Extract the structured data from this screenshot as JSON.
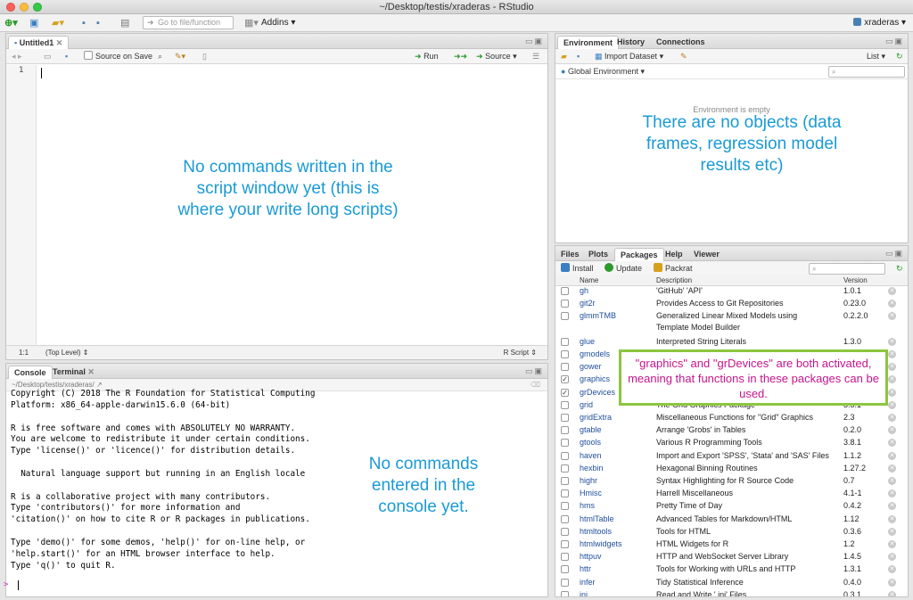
{
  "window": {
    "title": "~/Desktop/testis/xraderas - RStudio"
  },
  "toolbar": {
    "goto_placeholder": "Go to file/function",
    "addins": "Addins",
    "user": "xraderas"
  },
  "script": {
    "tab": "Untitled1",
    "source_on_save": "Source on Save",
    "run": "Run",
    "source": "Source",
    "line_number": "1",
    "position": "1:1",
    "level": "(Top Level)",
    "type": "R Script"
  },
  "console": {
    "tabs": [
      "Console",
      "Terminal"
    ],
    "path": "~/Desktop/testis/xraderas/",
    "lines": [
      "Copyright (C) 2018 The R Foundation for Statistical Computing",
      "Platform: x86_64-apple-darwin15.6.0 (64-bit)",
      "",
      "R is free software and comes with ABSOLUTELY NO WARRANTY.",
      "You are welcome to redistribute it under certain conditions.",
      "Type 'license()' or 'licence()' for distribution details.",
      "",
      "  Natural language support but running in an English locale",
      "",
      "R is a collaborative project with many contributors.",
      "Type 'contributors()' for more information and",
      "'citation()' on how to cite R or R packages in publications.",
      "",
      "Type 'demo()' for some demos, 'help()' for on-line help, or",
      "'help.start()' for an HTML browser interface to help.",
      "Type 'q()' to quit R.",
      ""
    ],
    "prompt": ">"
  },
  "environment": {
    "tabs": [
      "Environment",
      "History",
      "Connections"
    ],
    "import_dataset": "Import Dataset",
    "list": "List",
    "global": "Global Environment",
    "empty_text": "Environment is empty"
  },
  "packages": {
    "tabs": [
      "Files",
      "Plots",
      "Packages",
      "Help",
      "Viewer"
    ],
    "install": "Install",
    "update": "Update",
    "packrat": "Packrat",
    "columns": {
      "name": "Name",
      "description": "Description",
      "version": "Version"
    },
    "rows": [
      {
        "name": "gh",
        "description": "'GitHub' 'API'",
        "version": "1.0.1",
        "checked": false
      },
      {
        "name": "git2r",
        "description": "Provides Access to Git Repositories",
        "version": "0.23.0",
        "checked": false
      },
      {
        "name": "glmmTMB",
        "description": "Generalized Linear Mixed Models using",
        "description2": "Template Model Builder",
        "version": "0.2.2.0",
        "checked": false
      },
      {
        "name": "glue",
        "description": "Interpreted String Literals",
        "version": "1.3.0",
        "checked": false
      },
      {
        "name": "gmodels",
        "description": "Various R Programming Tools for Model Fitting",
        "version": "2.18.1",
        "checked": false
      },
      {
        "name": "gower",
        "description": "",
        "version": "",
        "checked": false
      },
      {
        "name": "graphics",
        "description": "",
        "version": "",
        "checked": true
      },
      {
        "name": "grDevices",
        "description": "",
        "version": "",
        "checked": true
      },
      {
        "name": "grid",
        "description": "The Grid Graphics Package",
        "version": "3.5.1",
        "checked": false
      },
      {
        "name": "gridExtra",
        "description": "Miscellaneous Functions for \"Grid\" Graphics",
        "version": "2.3",
        "checked": false
      },
      {
        "name": "gtable",
        "description": "Arrange 'Grobs' in Tables",
        "version": "0.2.0",
        "checked": false
      },
      {
        "name": "gtools",
        "description": "Various R Programming Tools",
        "version": "3.8.1",
        "checked": false
      },
      {
        "name": "haven",
        "description": "Import and Export 'SPSS', 'Stata' and 'SAS' Files",
        "version": "1.1.2",
        "checked": false
      },
      {
        "name": "hexbin",
        "description": "Hexagonal Binning Routines",
        "version": "1.27.2",
        "checked": false
      },
      {
        "name": "highr",
        "description": "Syntax Highlighting for R Source Code",
        "version": "0.7",
        "checked": false
      },
      {
        "name": "Hmisc",
        "description": "Harrell Miscellaneous",
        "version": "4.1-1",
        "checked": false
      },
      {
        "name": "hms",
        "description": "Pretty Time of Day",
        "version": "0.4.2",
        "checked": false
      },
      {
        "name": "htmlTable",
        "description": "Advanced Tables for Markdown/HTML",
        "version": "1.12",
        "checked": false
      },
      {
        "name": "htmltools",
        "description": "Tools for HTML",
        "version": "0.3.6",
        "checked": false
      },
      {
        "name": "htmlwidgets",
        "description": "HTML Widgets for R",
        "version": "1.2",
        "checked": false
      },
      {
        "name": "httpuv",
        "description": "HTTP and WebSocket Server Library",
        "version": "1.4.5",
        "checked": false
      },
      {
        "name": "httr",
        "description": "Tools for Working with URLs and HTTP",
        "version": "1.3.1",
        "checked": false
      },
      {
        "name": "infer",
        "description": "Tidy Statistical Inference",
        "version": "0.4.0",
        "checked": false
      },
      {
        "name": "ini",
        "description": "Read and Write '.ini' Files",
        "version": "0.3.1",
        "checked": false
      }
    ]
  },
  "annotations": {
    "script": "No commands written in the script window yet (this is where your write long scripts)",
    "console": "No commands entered in the console yet.",
    "environment": "There are no objects (data frames, regression model results etc)",
    "packages": "\"graphics\" and \"grDevices\" are both activated, meaning that functions in these packages can be used."
  },
  "colors": {
    "annotation": "#1a9ad6",
    "callout_text": "#c5158b",
    "callout_border": "#8cc63f"
  }
}
